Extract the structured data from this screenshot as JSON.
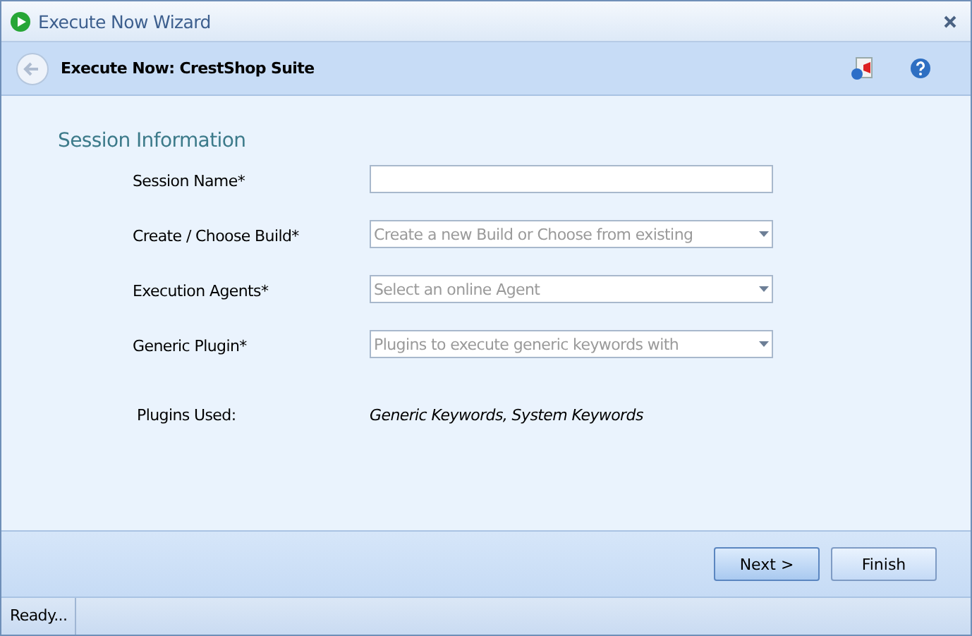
{
  "window": {
    "title": "Execute Now Wizard"
  },
  "header": {
    "title": "Execute Now: CrestShop Suite"
  },
  "section": {
    "title": "Session Information"
  },
  "fields": [
    {
      "label": "Session Name*",
      "kind": "text"
    },
    {
      "label": "Create / Choose Build*",
      "kind": "dropdown",
      "placeholder": "Create a new Build or Choose from existing"
    },
    {
      "label": "Execution Agents*",
      "kind": "dropdown",
      "placeholder": "Select an online Agent"
    },
    {
      "label": "Generic Plugin*",
      "kind": "dropdown",
      "placeholder": "Plugins to execute generic keywords with"
    }
  ],
  "plugins_used": {
    "label": "Plugins Used:",
    "value": "Generic Keywords, System Keywords"
  },
  "buttons": [
    {
      "label": "Next >",
      "default": true
    },
    {
      "label": "Finish",
      "default": false
    }
  ],
  "status_bar": {
    "text": "Ready..."
  }
}
